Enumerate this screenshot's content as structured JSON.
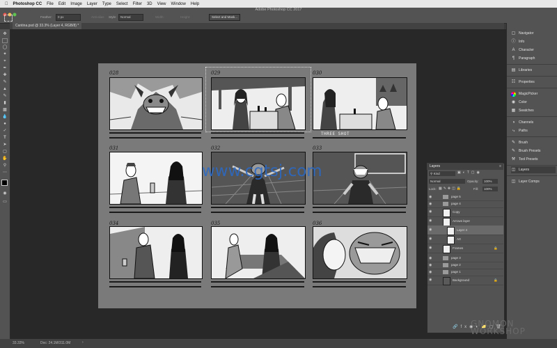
{
  "menubar": {
    "app": "Photoshop CC",
    "items": [
      "File",
      "Edit",
      "Image",
      "Layer",
      "Type",
      "Select",
      "Filter",
      "3D",
      "View",
      "Window",
      "Help"
    ]
  },
  "window_title": "Adobe Photoshop CC 2017",
  "options": {
    "feather_label": "Feather:",
    "feather_value": "0 px",
    "antialias_label": "Anti-alias",
    "style_label": "Style:",
    "style_value": "Normal",
    "width_label": "Width:",
    "height_label": "Height:",
    "select_mask_button": "Select and Mask..."
  },
  "document_tab": "Cantina.psd @ 33.3% (Layer 4, RGB/8) *",
  "storyboard": {
    "panels": [
      {
        "num": "028"
      },
      {
        "num": "029"
      },
      {
        "num": "030",
        "caption": "THREE SHOT"
      },
      {
        "num": "031"
      },
      {
        "num": "032"
      },
      {
        "num": "033"
      },
      {
        "num": "034"
      },
      {
        "num": "035"
      },
      {
        "num": "036"
      }
    ]
  },
  "watermark": "www.cgtsj.com",
  "watermark2": "GNOMON WORKSHOP",
  "dock": {
    "groups": [
      [
        "Navigator",
        "Info",
        "Character",
        "Paragraph"
      ],
      [
        "Libraries"
      ],
      [
        "Properties"
      ],
      [
        "MagicPicker",
        "Color",
        "Swatches"
      ],
      [
        "Channels",
        "Paths"
      ],
      [
        "Brush",
        "Brush Presets",
        "Tool Presets"
      ],
      [
        "Layers"
      ],
      [
        "Layer Comps"
      ]
    ]
  },
  "layers_panel": {
    "title": "Layers",
    "kind_label": "Kind",
    "blend_mode": "Normal",
    "opacity_label": "Opacity:",
    "opacity_value": "100%",
    "lock_label": "Lock:",
    "fill_label": "Fill:",
    "fill_value": "100%",
    "layers": [
      {
        "name": "page 5",
        "type": "group"
      },
      {
        "name": "page 4",
        "type": "group"
      },
      {
        "name": "Copy",
        "type": "layer"
      },
      {
        "name": "Arrows layer",
        "type": "layer"
      },
      {
        "name": "Layer 4",
        "type": "layer",
        "selected": true
      },
      {
        "name": "Art",
        "type": "layer"
      },
      {
        "name": "Frames",
        "type": "layer"
      },
      {
        "name": "page 3",
        "type": "group"
      },
      {
        "name": "page 2",
        "type": "group"
      },
      {
        "name": "page 1",
        "type": "group"
      },
      {
        "name": "Background",
        "type": "layer"
      }
    ]
  },
  "status": {
    "zoom": "33.33%",
    "doc": "Doc: 24.1M/311.0M"
  }
}
